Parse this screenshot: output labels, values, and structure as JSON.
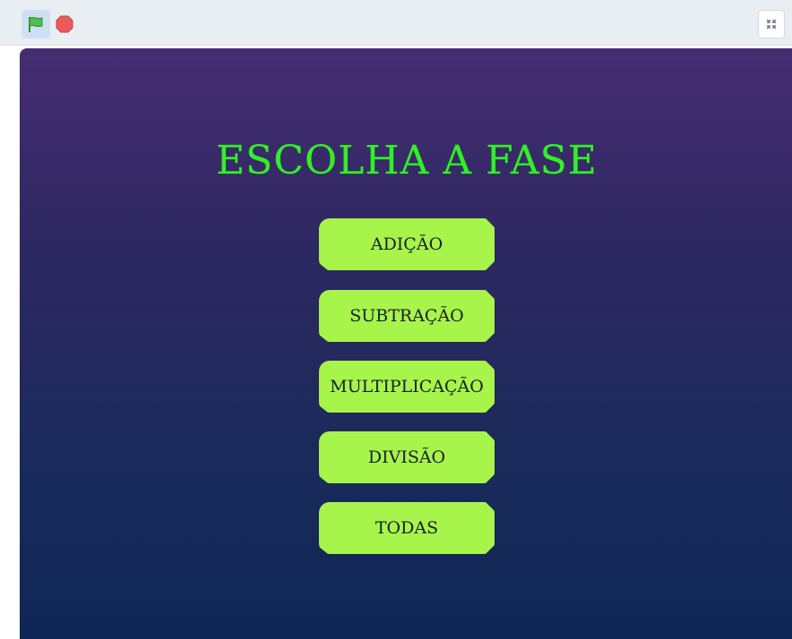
{
  "toolbar": {
    "flag_icon": "green-flag-icon",
    "stop_icon": "stop-icon",
    "fullscreen_icon": "exit-fullscreen-icon"
  },
  "stage": {
    "title": "ESCOLHA A FASE",
    "buttons": [
      {
        "label": "ADIÇÃO"
      },
      {
        "label": "SUBTRAÇÃO"
      },
      {
        "label": "MULTIPLICAÇÃO"
      },
      {
        "label": "DIVISÃO"
      },
      {
        "label": "TODAS"
      }
    ]
  },
  "colors": {
    "title": "#33ee2a",
    "button_bg": "#a7f44b",
    "stage_top": "#452d71",
    "stage_bottom": "#0f2755"
  }
}
